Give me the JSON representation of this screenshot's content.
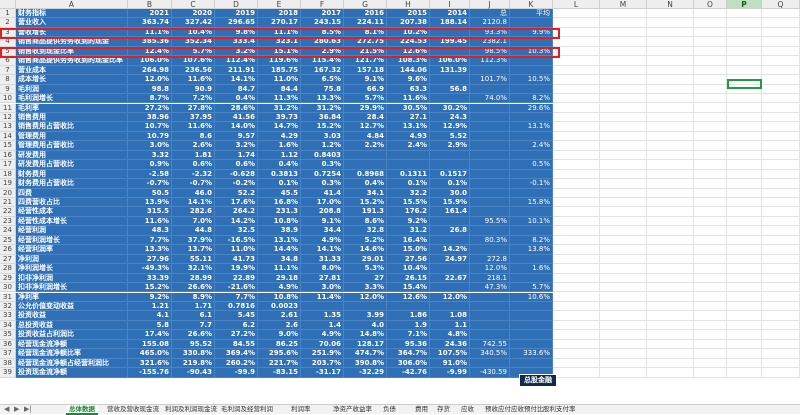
{
  "columns": [
    "A",
    "B",
    "C",
    "D",
    "E",
    "F",
    "G",
    "H",
    "I",
    "J",
    "K",
    "L",
    "M",
    "N",
    "O",
    "P",
    "Q"
  ],
  "selected_column": "P",
  "years": [
    "2021",
    "2020",
    "2019",
    "2018",
    "2017",
    "2016",
    "2015",
    "2014"
  ],
  "rows": [
    {
      "n": "1",
      "label": "财务指标",
      "v": [
        "2021",
        "2020",
        "2019",
        "2018",
        "2017",
        "2016",
        "2015",
        "2014"
      ],
      "j": "总",
      "k": "平均"
    },
    {
      "n": "2",
      "label": "营业收入",
      "v": [
        "363.74",
        "327.42",
        "296.65",
        "270.17",
        "243.15",
        "224.11",
        "207.38",
        "188.14"
      ],
      "j": "2120.8",
      "k": ""
    },
    {
      "n": "3",
      "label": "营收增长",
      "v": [
        "11.1%",
        "10.4%",
        "9.8%",
        "11.1%",
        "8.5%",
        "8.1%",
        "10.2%",
        ""
      ],
      "j": "93.3%",
      "k": "9.9%"
    },
    {
      "n": "4",
      "label": "销售商品提供劳务收到的现金",
      "v": [
        "385.36",
        "352.34",
        "333.4",
        "323.1",
        "280.63",
        "272.75",
        "224.53",
        "199.45"
      ],
      "j": "2382.1",
      "k": ""
    },
    {
      "n": "5",
      "label": "销售收到现金比率",
      "v": [
        "12.4%",
        "5.7%",
        "3.2%",
        "15.1%",
        "2.9%",
        "21.5%",
        "12.6%",
        ""
      ],
      "j": "98.5%",
      "k": "10.3%"
    },
    {
      "n": "6",
      "label": "销售商品提供劳务收到的现金比率",
      "v": [
        "106.0%",
        "107.6%",
        "112.4%",
        "119.6%",
        "115.4%",
        "121.7%",
        "108.3%",
        "106.0%"
      ],
      "j": "112.3%",
      "k": ""
    },
    {
      "n": "7",
      "label": "营业成本",
      "v": [
        "264.98",
        "236.56",
        "211.91",
        "185.75",
        "167.32",
        "157.18",
        "144.06",
        "131.39"
      ],
      "j": "",
      "k": ""
    },
    {
      "n": "8",
      "label": "成本增长",
      "v": [
        "12.0%",
        "11.6%",
        "14.1%",
        "11.0%",
        "6.5%",
        "9.1%",
        "9.6%",
        ""
      ],
      "j": "101.7%",
      "k": "10.5%"
    },
    {
      "n": "9",
      "label": "毛利润",
      "v": [
        "98.8",
        "90.9",
        "84.7",
        "84.4",
        "75.8",
        "66.9",
        "63.3",
        "56.8"
      ],
      "j": "",
      "k": ""
    },
    {
      "n": "10",
      "label": "毛利润增长",
      "v": [
        "8.7%",
        "7.2%",
        "0.4%",
        "11.3%",
        "13.3%",
        "5.7%",
        "11.6%",
        ""
      ],
      "j": "74.0%",
      "k": "8.2%"
    },
    {
      "n": "11",
      "label": "毛利率",
      "v": [
        "27.2%",
        "27.8%",
        "28.6%",
        "31.2%",
        "31.2%",
        "29.9%",
        "30.5%",
        "30.2%"
      ],
      "j": "",
      "k": "29.6%"
    },
    {
      "n": "12",
      "label": "销售费用",
      "v": [
        "38.96",
        "37.95",
        "41.56",
        "39.73",
        "36.84",
        "28.4",
        "27.1",
        "24.3"
      ],
      "j": "",
      "k": ""
    },
    {
      "n": "13",
      "label": "销售费用占营收比",
      "v": [
        "10.7%",
        "11.6%",
        "14.0%",
        "14.7%",
        "15.2%",
        "12.7%",
        "13.1%",
        "12.9%"
      ],
      "j": "",
      "k": "13.1%"
    },
    {
      "n": "14",
      "label": "管理费用",
      "v": [
        "10.79",
        "8.6",
        "9.57",
        "4.29",
        "3.03",
        "4.84",
        "4.93",
        "5.52"
      ],
      "j": "",
      "k": ""
    },
    {
      "n": "15",
      "label": "管理费用占营收比",
      "v": [
        "3.0%",
        "2.6%",
        "3.2%",
        "1.6%",
        "1.2%",
        "2.2%",
        "2.4%",
        "2.9%"
      ],
      "j": "",
      "k": "2.4%"
    },
    {
      "n": "16",
      "label": "研发费用",
      "v": [
        "3.32",
        "1.81",
        "1.74",
        "1.12",
        "0.8403",
        "",
        "",
        ""
      ],
      "j": "",
      "k": ""
    },
    {
      "n": "17",
      "label": "研发费用占营收比",
      "v": [
        "0.9%",
        "0.6%",
        "0.6%",
        "0.4%",
        "0.3%",
        "",
        "",
        ""
      ],
      "j": "",
      "k": "0.5%"
    },
    {
      "n": "18",
      "label": "财务费用",
      "v": [
        "-2.58",
        "-2.32",
        "-0.628",
        "0.3813",
        "0.7254",
        "0.8968",
        "0.1311",
        "0.1517"
      ],
      "j": "",
      "k": ""
    },
    {
      "n": "19",
      "label": "财务费用占营收比",
      "v": [
        "-0.7%",
        "-0.7%",
        "-0.2%",
        "0.1%",
        "0.3%",
        "0.4%",
        "0.1%",
        "0.1%"
      ],
      "j": "",
      "k": "-0.1%"
    },
    {
      "n": "20",
      "label": "四费",
      "v": [
        "50.5",
        "46.0",
        "52.2",
        "45.5",
        "41.4",
        "34.1",
        "32.2",
        "30.0"
      ],
      "j": "",
      "k": ""
    },
    {
      "n": "21",
      "label": "四费营收占比",
      "v": [
        "13.9%",
        "14.1%",
        "17.6%",
        "16.8%",
        "17.0%",
        "15.2%",
        "15.5%",
        "15.9%"
      ],
      "j": "",
      "k": "15.8%"
    },
    {
      "n": "22",
      "label": "经营性成本",
      "v": [
        "315.5",
        "282.6",
        "264.2",
        "231.3",
        "208.8",
        "191.3",
        "176.2",
        "161.4"
      ],
      "j": "",
      "k": ""
    },
    {
      "n": "23",
      "label": "经营性成本增长",
      "v": [
        "11.6%",
        "7.0%",
        "14.2%",
        "10.8%",
        "9.1%",
        "8.6%",
        "9.2%",
        ""
      ],
      "j": "95.5%",
      "k": "10.1%"
    },
    {
      "n": "24",
      "label": "经营利润",
      "v": [
        "48.3",
        "44.8",
        "32.5",
        "38.9",
        "34.4",
        "32.8",
        "31.2",
        "26.8"
      ],
      "j": "",
      "k": ""
    },
    {
      "n": "25",
      "label": "经营利润增长",
      "v": [
        "7.7%",
        "37.9%",
        "-16.5%",
        "13.1%",
        "4.9%",
        "5.2%",
        "16.4%",
        ""
      ],
      "j": "80.3%",
      "k": "8.2%"
    },
    {
      "n": "26",
      "label": "经营利润率",
      "v": [
        "13.3%",
        "13.7%",
        "11.0%",
        "14.4%",
        "14.1%",
        "14.6%",
        "15.0%",
        "14.2%"
      ],
      "j": "",
      "k": "13.8%"
    },
    {
      "n": "27",
      "label": "净利润",
      "v": [
        "27.96",
        "55.11",
        "41.73",
        "34.8",
        "31.33",
        "29.01",
        "27.56",
        "24.97"
      ],
      "j": "272.8",
      "k": ""
    },
    {
      "n": "28",
      "label": "净利润增长",
      "v": [
        "-49.3%",
        "32.1%",
        "19.9%",
        "11.1%",
        "8.0%",
        "5.3%",
        "10.4%",
        ""
      ],
      "j": "12.0%",
      "k": "1.6%"
    },
    {
      "n": "29",
      "label": "扣非净利润",
      "v": [
        "33.39",
        "28.99",
        "22.89",
        "29.18",
        "27.81",
        "27",
        "26.15",
        "22.67"
      ],
      "j": "218.1",
      "k": ""
    },
    {
      "n": "30",
      "label": "扣非净利润增长",
      "v": [
        "15.2%",
        "26.6%",
        "-21.6%",
        "4.9%",
        "3.0%",
        "3.3%",
        "15.4%",
        ""
      ],
      "j": "47.3%",
      "k": "5.7%"
    },
    {
      "n": "31",
      "label": "净利率",
      "v": [
        "9.2%",
        "8.9%",
        "7.7%",
        "10.8%",
        "11.4%",
        "12.0%",
        "12.6%",
        "12.0%"
      ],
      "j": "",
      "k": "10.6%"
    },
    {
      "n": "32",
      "label": "公允价值变动收益",
      "v": [
        "1.21",
        "1.71",
        "0.7816",
        "0.0023",
        "",
        "",
        "",
        ""
      ],
      "j": "",
      "k": ""
    },
    {
      "n": "33",
      "label": "投资收益",
      "v": [
        "4.1",
        "6.1",
        "5.45",
        "2.61",
        "1.35",
        "3.99",
        "1.86",
        "1.08"
      ],
      "j": "",
      "k": ""
    },
    {
      "n": "34",
      "label": "总投资收益",
      "v": [
        "5.8",
        "7.7",
        "6.2",
        "2.6",
        "1.4",
        "4.0",
        "1.9",
        "1.1"
      ],
      "j": "",
      "k": ""
    },
    {
      "n": "35",
      "label": "投资收益占利润比",
      "v": [
        "17.4%",
        "26.6%",
        "27.2%",
        "9.0%",
        "4.9%",
        "14.8%",
        "7.1%",
        "4.8%"
      ],
      "j": "",
      "k": ""
    },
    {
      "n": "36",
      "label": "经营现金流净额",
      "v": [
        "155.08",
        "95.52",
        "84.55",
        "86.25",
        "70.06",
        "128.17",
        "95.36",
        "24.36"
      ],
      "j": "742.55",
      "k": ""
    },
    {
      "n": "37",
      "label": "经营现金流净额比率",
      "v": [
        "465.0%",
        "330.8%",
        "369.4%",
        "295.6%",
        "251.9%",
        "474.7%",
        "364.7%",
        "107.5%"
      ],
      "j": "340.5%",
      "k": "333.6%"
    },
    {
      "n": "38",
      "label": "经营现金流净额占经营利润比",
      "v": [
        "321.6%",
        "219.8%",
        "260.2%",
        "221.7%",
        "203.7%",
        "390.8%",
        "306.0%",
        "91.0%"
      ],
      "j": "",
      "k": ""
    },
    {
      "n": "39",
      "label": "投资现金流净额",
      "v": [
        "-155.76",
        "-90.43",
        "-99.9",
        "-83.15",
        "-31.17",
        "-32.29",
        "-42.76",
        "-9.99"
      ],
      "j": "-430.59",
      "k": ""
    }
  ],
  "stamp_text": "总股金融",
  "tabs": [
    "总体数据",
    "营收及营收现金流",
    "利润及利润现金流",
    "毛利润及经营利润",
    "利润率",
    "净资产收益率",
    "负债",
    "费用",
    "存货",
    "应收",
    "预收应付应收预付比",
    "股利支付率"
  ],
  "active_tab": "总体数据"
}
